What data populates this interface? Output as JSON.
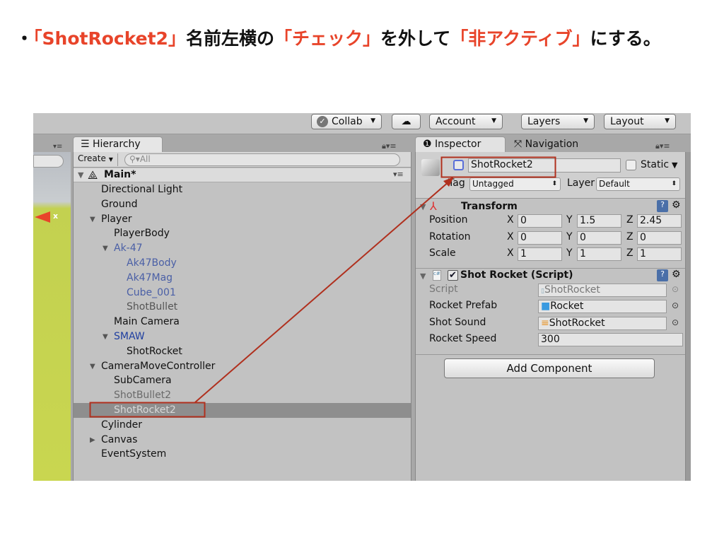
{
  "caption": {
    "p1": "・",
    "r1": "「ShotRocket2」",
    "p2": "名前左横の",
    "r2": "「チェック」",
    "p3": "を外して",
    "r3": "「非アクティブ」",
    "p4": "にする。"
  },
  "toolbar": {
    "collab": "Collab",
    "account": "Account",
    "layers": "Layers",
    "layout": "Layout"
  },
  "hierarchy": {
    "tab": "Hierarchy",
    "create": "Create",
    "search_placeholder": "All",
    "scene": "Main*",
    "items": [
      {
        "label": "Directional Light",
        "level": 1,
        "state": "normal"
      },
      {
        "label": "Ground",
        "level": 1,
        "state": "normal"
      },
      {
        "label": "Player",
        "level": 1,
        "state": "normal",
        "expanded": true
      },
      {
        "label": "PlayerBody",
        "level": 2,
        "state": "normal"
      },
      {
        "label": "Ak-47",
        "level": 2,
        "state": "prefab",
        "expanded": true
      },
      {
        "label": "Ak47Body",
        "level": 3,
        "state": "prefab"
      },
      {
        "label": "Ak47Mag",
        "level": 3,
        "state": "prefab"
      },
      {
        "label": "Cube_001",
        "level": 3,
        "state": "prefab"
      },
      {
        "label": "ShotBullet",
        "level": 3,
        "state": "dim"
      },
      {
        "label": "Main Camera",
        "level": 2,
        "state": "normal"
      },
      {
        "label": "SMAW",
        "level": 2,
        "state": "prefab-dark",
        "expanded": true
      },
      {
        "label": "ShotRocket",
        "level": 3,
        "state": "normal"
      },
      {
        "label": "CameraMoveController",
        "level": 1,
        "state": "normal",
        "expanded": true
      },
      {
        "label": "SubCamera",
        "level": 2,
        "state": "normal"
      },
      {
        "label": "ShotBullet2",
        "level": 2,
        "state": "inactive"
      },
      {
        "label": "ShotRocket2",
        "level": 2,
        "state": "inactive",
        "selected": true
      },
      {
        "label": "Cylinder",
        "level": 1,
        "state": "normal"
      },
      {
        "label": "Canvas",
        "level": 1,
        "state": "normal",
        "collapsed": true
      },
      {
        "label": "EventSystem",
        "level": 1,
        "state": "normal"
      }
    ]
  },
  "inspector": {
    "tab": "Inspector",
    "nav_tab": "Navigation",
    "name": "ShotRocket2",
    "active": false,
    "static_label": "Static",
    "tag_label": "Tag",
    "tag": "Untagged",
    "layer_label": "Layer",
    "layer": "Default",
    "transform": {
      "title": "Transform",
      "rows": [
        {
          "label": "Position",
          "x": "0",
          "y": "1.5",
          "z": "2.45"
        },
        {
          "label": "Rotation",
          "x": "0",
          "y": "0",
          "z": "0"
        },
        {
          "label": "Scale",
          "x": "1",
          "y": "1",
          "z": "1"
        }
      ]
    },
    "script": {
      "title": "Shot Rocket (Script)",
      "enabled": true,
      "fields": [
        {
          "label": "Script",
          "value": "ShotRocket",
          "icon": "cs-script-icon"
        },
        {
          "label": "Rocket Prefab",
          "value": "Rocket",
          "icon": "prefab-cube-icon"
        },
        {
          "label": "Shot Sound",
          "value": "ShotRocket",
          "icon": "audio-icon"
        },
        {
          "label": "Rocket Speed",
          "value": "300"
        }
      ]
    },
    "add_component": "Add Component"
  },
  "colors": {
    "accent": "#e8442a",
    "annotation": "#b0301e",
    "selected_row": "#8e8e8e",
    "prefab_text": "#4a5fa6"
  }
}
